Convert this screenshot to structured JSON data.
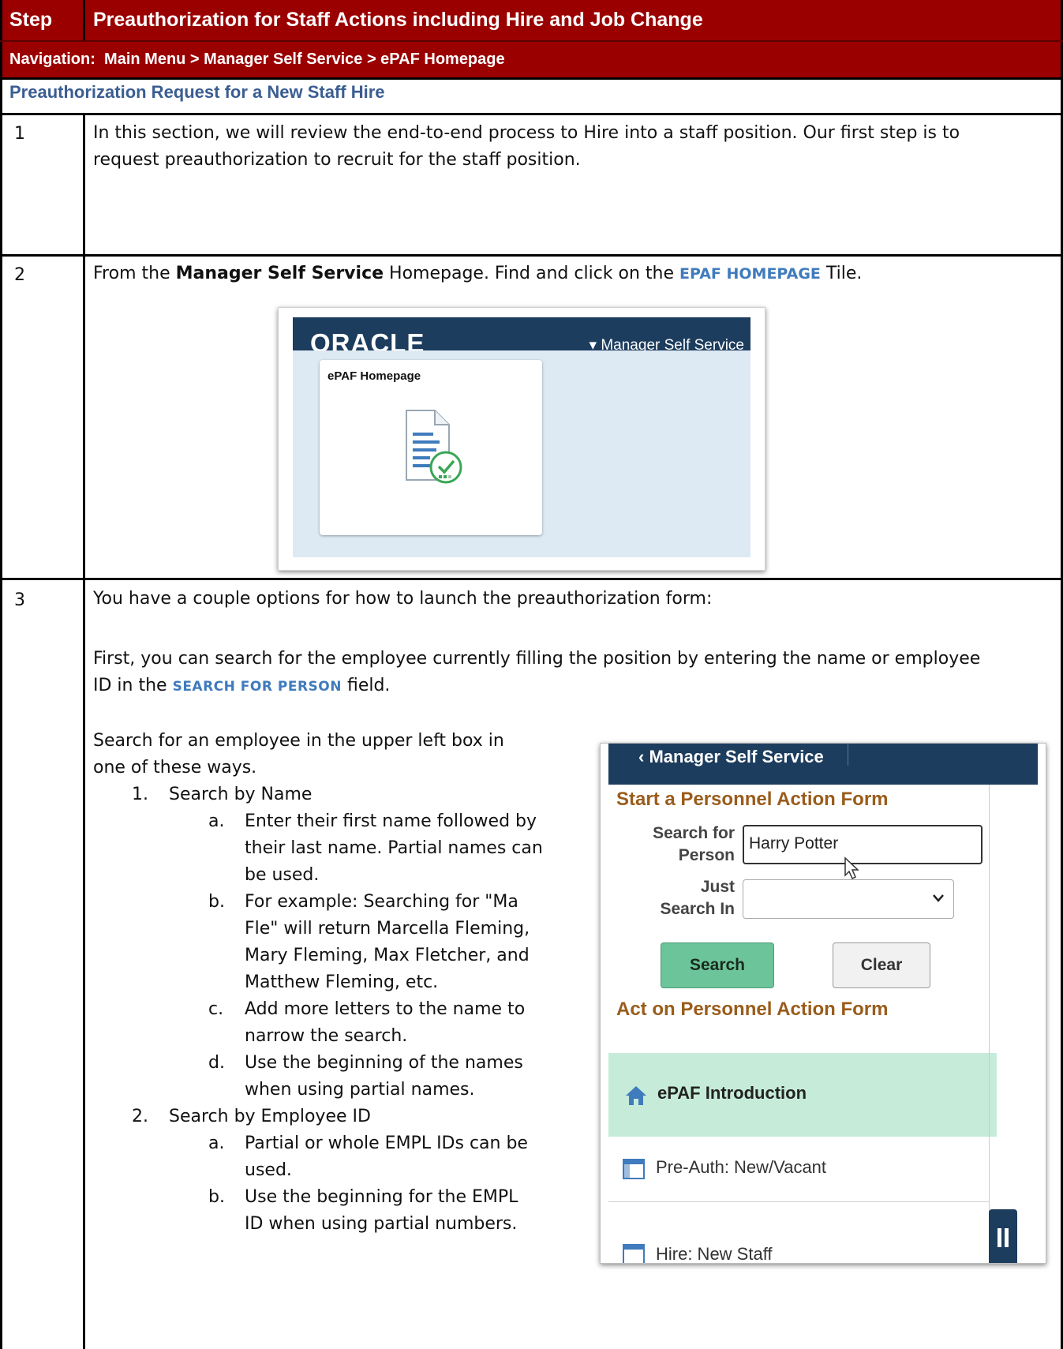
{
  "header": {
    "step_label": "Step",
    "title": "Preauthorization for Staff Actions including Hire and Job Change",
    "nav_label": "Navigation",
    "nav_sep": ":",
    "nav_path": "Main Menu > Manager Self Service > ePAF Homepage"
  },
  "subheading": "Preauthorization Request for a New Staff Hire",
  "steps": [
    {
      "number": "1",
      "text_line1": "In this section, we will review the end-to-end process to Hire into a staff position. Our first step is to",
      "text_line2": "request preauthorization to recruit for the staff position."
    },
    {
      "number": "2",
      "prefix": "From the ",
      "bold": "Manager Self Service",
      "middle": " Homepage. Find and click on the ",
      "keyword": "EPAF HOMEPAGE",
      "suffix": " Tile."
    },
    {
      "number": "3",
      "intro": "You have a couple options for how to launch the preauthorization form:",
      "first_line1": "First, you can search for the employee currently filling the position by entering the name or employee",
      "first_line2_prefix": "ID in the ",
      "first_line2_keyword": "SEARCH FOR PERSON",
      "first_line2_suffix": " field.",
      "search_line1": "Search for an employee in the upper left box in",
      "search_line2": "one of these ways.",
      "list": [
        {
          "marker": "1.",
          "text": "Search by Name"
        },
        {
          "marker": "a.",
          "lines": [
            "Enter their first name followed by",
            "their last name. Partial names can",
            "be used."
          ]
        },
        {
          "marker": "b.",
          "lines": [
            "For example: Searching for \"Ma",
            "Fle\" will return Marcella Fleming,",
            "Mary Fleming, Max Fletcher, and",
            "Matthew Fleming, etc."
          ]
        },
        {
          "marker": "c.",
          "lines": [
            "Add more letters to the name to",
            "narrow the search."
          ]
        },
        {
          "marker": "d.",
          "lines": [
            "Use the beginning of the names",
            "when using partial names."
          ]
        },
        {
          "marker": "2.",
          "text": "Search by Employee ID"
        },
        {
          "marker": "a.",
          "lines": [
            "Partial or whole EMPL IDs can be",
            "used."
          ]
        },
        {
          "marker": "b.",
          "lines": [
            "Use the beginning for the EMPL",
            "ID when using partial numbers."
          ]
        }
      ]
    }
  ],
  "oracle_screenshot": {
    "brand": "ORACLE",
    "menu": "▾ Manager Self Service",
    "tile_title": "ePAF Homepage",
    "colors": {
      "bar": "#1d3d5e",
      "background": "#dde9f3",
      "check": "#3aa655"
    }
  },
  "paf_screenshot": {
    "back": "‹  Manager Self Service",
    "section_start": "Start a Personnel Action Form",
    "search_label_1": "Search for",
    "search_label_2": "Person",
    "search_value": "Harry Potter",
    "just_label_1": "Just",
    "just_label_2": "Search In",
    "search_button": "Search",
    "clear_button": "Clear",
    "section_act": "Act on Personnel Action Form",
    "item_intro": "ePAF Introduction",
    "item_preauth": "Pre-Auth: New/Vacant",
    "item_hire": "Hire: New Staff",
    "colors": {
      "section": "#9a5c1b",
      "search_button": "#6cc59a",
      "intro_highlight": "#c6ecd9"
    }
  }
}
